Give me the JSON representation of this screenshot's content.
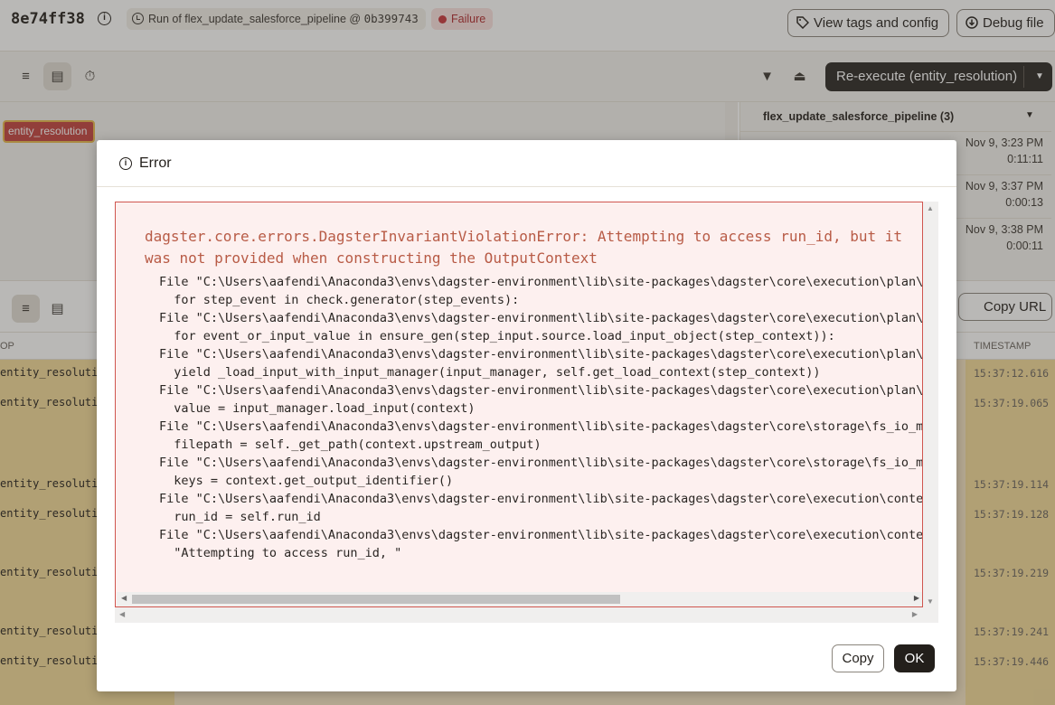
{
  "header": {
    "run_id": "8e74ff38",
    "run_chip_prefix": "Run of flex_update_salesforce_pipeline @",
    "run_chip_commit": "0b399743",
    "status": "Failure",
    "view_tags_label": "View tags and config",
    "debug_file_label": "Debug file"
  },
  "toolbar": {
    "reexecute_label": "Re-execute (entity_resolution)"
  },
  "gantt": {
    "step_label": "entity_resolution"
  },
  "runs_panel": {
    "title": "flex_update_salesforce_pipeline (3)",
    "runs": [
      {
        "date": "Nov 9, 3:23 PM",
        "duration": "0:11:11"
      },
      {
        "date": "Nov 9, 3:37 PM",
        "duration": "0:00:13"
      },
      {
        "date": "Nov 9, 3:38 PM",
        "duration": "0:00:11"
      }
    ]
  },
  "logs": {
    "copy_url_label": "Copy URL",
    "col_op": "OP",
    "col_timestamp": "TIMESTAMP",
    "rows": [
      {
        "op": "entity_resolution",
        "ts": "15:37:12.616"
      },
      {
        "op": "entity_resolution",
        "ts": "15:37:19.065"
      },
      {
        "op": "entity_resolution",
        "ts": "15:37:19.114"
      },
      {
        "op": "entity_resolution",
        "ts": "15:37:19.128"
      },
      {
        "op": "entity_resolution",
        "ts": "15:37:19.219"
      },
      {
        "op": "entity_resolution",
        "ts": "15:37:19.241"
      },
      {
        "op": "entity_resolution",
        "ts": "15:37:19.446"
      }
    ]
  },
  "dialog": {
    "title": "Error",
    "message": "dagster.core.errors.DagsterInvariantViolationError: Attempting to access run_id, but it was not provided when constructing the OutputContext",
    "stack": [
      "File \"C:\\Users\\aafendi\\Anaconda3\\envs\\dagster-environment\\lib\\site-packages\\dagster\\core\\execution\\plan\\ex",
      "  for step_event in check.generator(step_events):",
      "File \"C:\\Users\\aafendi\\Anaconda3\\envs\\dagster-environment\\lib\\site-packages\\dagster\\core\\execution\\plan\\ex",
      "  for event_or_input_value in ensure_gen(step_input.source.load_input_object(step_context)):",
      "File \"C:\\Users\\aafendi\\Anaconda3\\envs\\dagster-environment\\lib\\site-packages\\dagster\\core\\execution\\plan\\in",
      "  yield _load_input_with_input_manager(input_manager, self.get_load_context(step_context))",
      "File \"C:\\Users\\aafendi\\Anaconda3\\envs\\dagster-environment\\lib\\site-packages\\dagster\\core\\execution\\plan\\in",
      "  value = input_manager.load_input(context)",
      "File \"C:\\Users\\aafendi\\Anaconda3\\envs\\dagster-environment\\lib\\site-packages\\dagster\\core\\storage\\fs_io_man",
      "  filepath = self._get_path(context.upstream_output)",
      "File \"C:\\Users\\aafendi\\Anaconda3\\envs\\dagster-environment\\lib\\site-packages\\dagster\\core\\storage\\fs_io_man",
      "  keys = context.get_output_identifier()",
      "File \"C:\\Users\\aafendi\\Anaconda3\\envs\\dagster-environment\\lib\\site-packages\\dagster\\core\\execution\\context",
      "  run_id = self.run_id",
      "File \"C:\\Users\\aafendi\\Anaconda3\\envs\\dagster-environment\\lib\\site-packages\\dagster\\core\\execution\\context",
      "  \"Attempting to access run_id, \""
    ],
    "copy_label": "Copy",
    "ok_label": "OK"
  }
}
